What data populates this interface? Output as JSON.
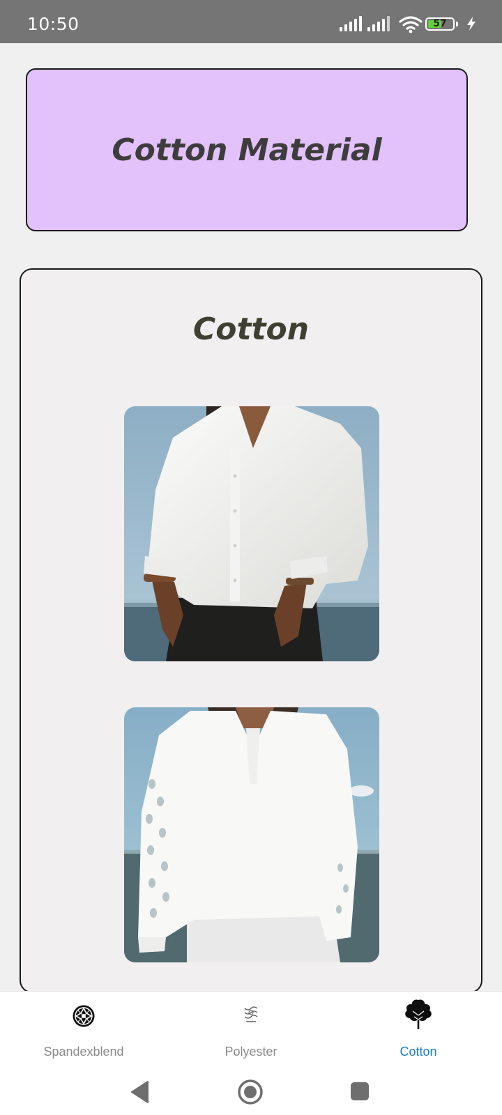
{
  "status_bar": {
    "time": "10:50",
    "battery_level": 57,
    "battery_text": "57",
    "icons": [
      "signal-icon",
      "signal-icon",
      "wifi-icon",
      "battery-icon",
      "charging-bolt-icon"
    ],
    "accent_battery": "#63d13a"
  },
  "header": {
    "title": "Cotton Material",
    "background": "#e3c1fb"
  },
  "section": {
    "title": "Cotton",
    "images": [
      {
        "name": "white-cotton-shirt-photo"
      },
      {
        "name": "white-eyelet-blouse-photo"
      }
    ]
  },
  "bottom_nav": {
    "items": [
      {
        "label": "Spandexblend",
        "icon": "spandex-pattern-icon",
        "active": false
      },
      {
        "label": "Polyester",
        "icon": "polyester-molecule-icon",
        "active": false
      },
      {
        "label": "Cotton",
        "icon": "cotton-plant-icon",
        "active": true
      }
    ],
    "active_color": "#1a7fc4"
  },
  "system_nav": {
    "buttons": [
      "back-icon",
      "home-icon",
      "recents-icon"
    ]
  }
}
